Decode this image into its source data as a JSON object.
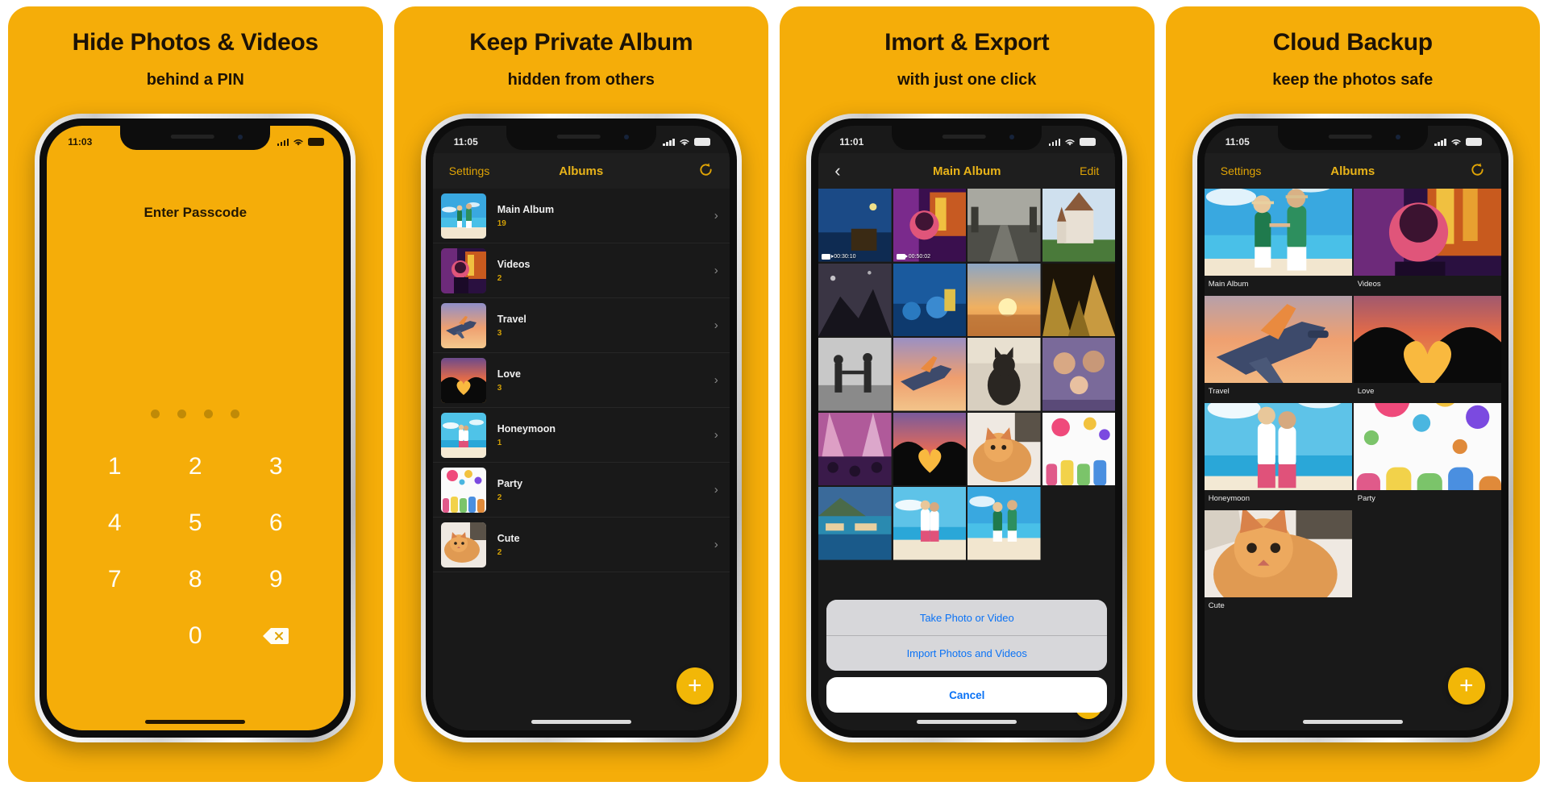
{
  "panels": [
    {
      "title": "Hide Photos & Videos",
      "subtitle": "behind a PIN",
      "status_time": "11:03",
      "passcode": {
        "prompt": "Enter Passcode",
        "dots": 4,
        "keys": [
          "1",
          "2",
          "3",
          "4",
          "5",
          "6",
          "7",
          "8",
          "9",
          "",
          "0",
          "delete"
        ],
        "delete_icon": "backspace-icon"
      }
    },
    {
      "title": "Keep Private Album",
      "subtitle": "hidden from others",
      "status_time": "11:05",
      "navbar": {
        "left": "Settings",
        "title": "Albums",
        "right_icon": "refresh-icon"
      },
      "albums": [
        {
          "name": "Main Album",
          "count": "19"
        },
        {
          "name": "Videos",
          "count": "2"
        },
        {
          "name": "Travel",
          "count": "3"
        },
        {
          "name": "Love",
          "count": "3"
        },
        {
          "name": "Honeymoon",
          "count": "1"
        },
        {
          "name": "Party",
          "count": "2"
        },
        {
          "name": "Cute",
          "count": "2"
        }
      ],
      "fab_label": "+"
    },
    {
      "title": "Imort & Export",
      "subtitle": "with just one click",
      "status_time": "11:01",
      "navbar": {
        "left_icon": "chevron-left-icon",
        "title": "Main Album",
        "right": "Edit"
      },
      "video_badges": [
        "00:30:10",
        "00:50:02"
      ],
      "action_sheet": {
        "options": [
          "Take Photo or Video",
          "Import Photos and Videos"
        ],
        "cancel": "Cancel"
      }
    },
    {
      "title": "Cloud Backup",
      "subtitle": "keep the photos safe",
      "status_time": "11:05",
      "navbar": {
        "left": "Settings",
        "title": "Albums",
        "right_icon": "refresh-icon"
      },
      "albums": [
        {
          "name": "Main Album"
        },
        {
          "name": "Videos"
        },
        {
          "name": "Travel"
        },
        {
          "name": "Love"
        },
        {
          "name": "Honeymoon"
        },
        {
          "name": "Party"
        },
        {
          "name": "Cute"
        }
      ],
      "fab_label": "+"
    }
  ],
  "colors": {
    "brand_yellow": "#f5ad09",
    "accent_yellow": "#e8b319",
    "dark_bg": "#191919",
    "ios_blue": "#0a72f5"
  }
}
